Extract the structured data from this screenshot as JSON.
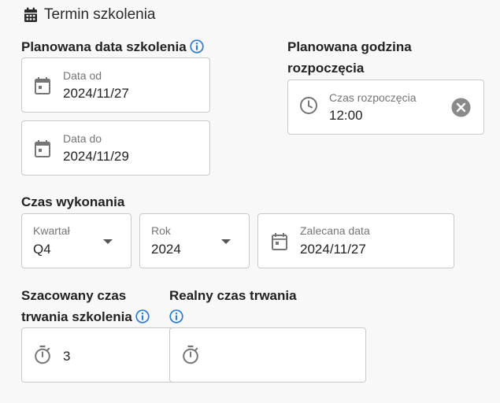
{
  "section": {
    "title": "Termin szkolenia"
  },
  "planned_date": {
    "label": "Planowana data szkolenia",
    "from": {
      "caption": "Data od",
      "value": "2024/11/27"
    },
    "to": {
      "caption": "Data do",
      "value": "2024/11/29"
    }
  },
  "planned_time": {
    "label_line1": "Planowana godzina",
    "label_line2": "rozpoczęcia",
    "field": {
      "caption": "Czas rozpoczęcia",
      "value": "12:00"
    }
  },
  "execution": {
    "label": "Czas wykonania",
    "quarter": {
      "caption": "Kwartał",
      "value": "Q4"
    },
    "year": {
      "caption": "Rok",
      "value": "2024"
    },
    "recommended": {
      "caption": "Zalecana data",
      "value": "2024/11/27"
    }
  },
  "estimated": {
    "label_line1": "Szacowany czas",
    "label_line2": "trwania szkolenia",
    "value": "3"
  },
  "real": {
    "label": "Realny czas trwania",
    "value": ""
  },
  "colors": {
    "info_icon": "#2b7bd0",
    "icon_gray": "#757575",
    "border": "#c9c9c9"
  }
}
